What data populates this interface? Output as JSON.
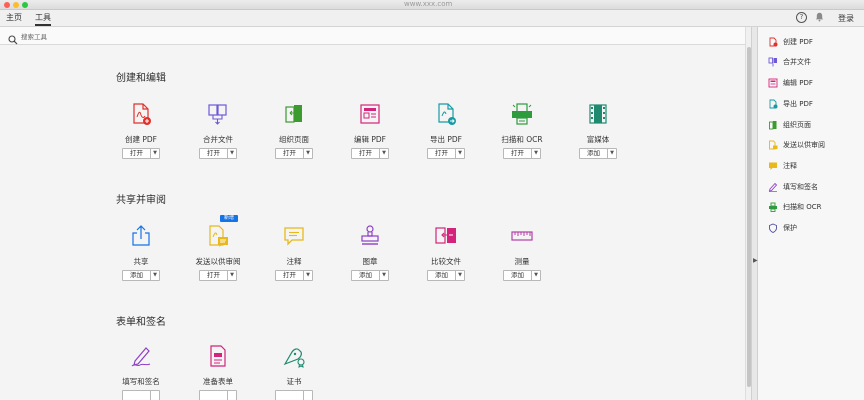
{
  "window": {
    "watermark": "www.xxx.com"
  },
  "nav": {
    "home": "主页",
    "tools": "工具",
    "help": "?",
    "login": "登录"
  },
  "search": {
    "placeholder": "搜索工具"
  },
  "sections": {
    "create_edit": "创建和编辑",
    "share_review": "共享并审阅",
    "forms_sign": "表单和签名"
  },
  "tools_create_edit": [
    {
      "label": "创建 PDF",
      "button": "打开",
      "icon": "create-pdf-icon"
    },
    {
      "label": "合并文件",
      "button": "打开",
      "icon": "combine-files-icon"
    },
    {
      "label": "组织页面",
      "button": "打开",
      "icon": "organize-pages-icon"
    },
    {
      "label": "编辑 PDF",
      "button": "打开",
      "icon": "edit-pdf-icon"
    },
    {
      "label": "导出 PDF",
      "button": "打开",
      "icon": "export-pdf-icon"
    },
    {
      "label": "扫描和 OCR",
      "button": "打开",
      "icon": "scan-ocr-icon"
    },
    {
      "label": "富媒体",
      "button": "添加",
      "icon": "rich-media-icon"
    }
  ],
  "tools_share_review": [
    {
      "label": "共享",
      "button": "添加",
      "icon": "share-icon"
    },
    {
      "label": "发送以供审阅",
      "button": "打开",
      "icon": "send-review-icon",
      "badge": "新增"
    },
    {
      "label": "注释",
      "button": "打开",
      "icon": "comment-icon"
    },
    {
      "label": "图章",
      "button": "添加",
      "icon": "stamp-icon"
    },
    {
      "label": "比较文件",
      "button": "添加",
      "icon": "compare-files-icon"
    },
    {
      "label": "测量",
      "button": "添加",
      "icon": "measure-icon"
    }
  ],
  "tools_forms_sign": [
    {
      "label": "填写和签名",
      "button": "",
      "icon": "fill-sign-icon"
    },
    {
      "label": "准备表单",
      "button": "",
      "icon": "prepare-form-icon"
    },
    {
      "label": "证书",
      "button": "",
      "icon": "certificate-icon"
    }
  ],
  "right_pane": [
    {
      "label": "创建 PDF",
      "icon": "create-pdf-icon",
      "color": "#e0312b"
    },
    {
      "label": "合并文件",
      "icon": "combine-files-icon",
      "color": "#6e58d8"
    },
    {
      "label": "编辑 PDF",
      "icon": "edit-pdf-icon",
      "color": "#d4237a"
    },
    {
      "label": "导出 PDF",
      "icon": "export-pdf-icon",
      "color": "#169ba5"
    },
    {
      "label": "组织页面",
      "icon": "organize-pages-icon",
      "color": "#3b9b2f"
    },
    {
      "label": "发送以供审阅",
      "icon": "send-review-icon",
      "color": "#e8b919"
    },
    {
      "label": "注释",
      "icon": "comment-icon",
      "color": "#e8b919"
    },
    {
      "label": "填写和签名",
      "icon": "fill-sign-icon",
      "color": "#8d3fc4"
    },
    {
      "label": "扫描和 OCR",
      "icon": "scan-ocr-icon",
      "color": "#2e9b3c"
    },
    {
      "label": "保护",
      "icon": "protect-icon",
      "color": "#4d4d9c"
    }
  ],
  "colors": {
    "red": "#e0312b",
    "purple": "#6e58d8",
    "green": "#3b9b2f",
    "pink": "#d4237a",
    "teal": "#169ba5",
    "scan_green": "#2e9b3c",
    "media_teal": "#1f8a6f",
    "blue": "#1473e6",
    "yellow": "#e8b919",
    "violet": "#8d3fc4",
    "magenta": "#b43fa8"
  }
}
